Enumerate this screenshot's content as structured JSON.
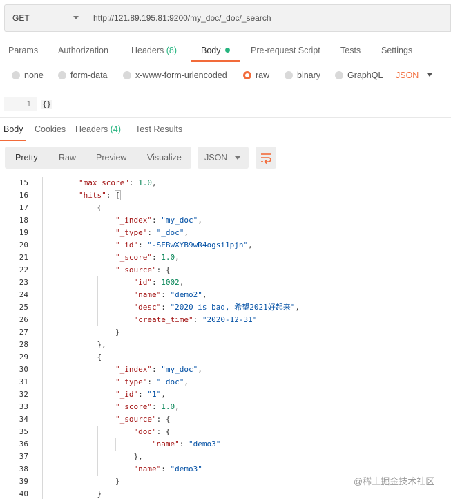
{
  "request": {
    "method": "GET",
    "url": "http://121.89.195.81:9200/my_doc/_doc/_search"
  },
  "request_tabs": [
    {
      "label": "Params",
      "count": ""
    },
    {
      "label": "Authorization",
      "count": ""
    },
    {
      "label": "Headers",
      "count": "(8)"
    },
    {
      "label": "Body",
      "count": ""
    },
    {
      "label": "Pre-request Script",
      "count": ""
    },
    {
      "label": "Tests",
      "count": ""
    },
    {
      "label": "Settings",
      "count": ""
    }
  ],
  "body_types": [
    "none",
    "form-data",
    "x-www-form-urlencoded",
    "raw",
    "binary",
    "GraphQL"
  ],
  "body_selected": "raw",
  "body_format": "JSON",
  "request_body": {
    "line": "1",
    "code": "{}"
  },
  "response_tabs": [
    {
      "label": "Body",
      "count": ""
    },
    {
      "label": "Cookies",
      "count": ""
    },
    {
      "label": "Headers",
      "count": "(4)"
    },
    {
      "label": "Test Results",
      "count": ""
    }
  ],
  "view_modes": [
    "Pretty",
    "Raw",
    "Preview",
    "Visualize"
  ],
  "response_format": "JSON",
  "response_lines": [
    {
      "n": "15",
      "i": 2,
      "parts": [
        [
          "k",
          "\"max_score\""
        ],
        [
          "",
          ": "
        ],
        [
          "n",
          "1.0"
        ],
        [
          "",
          ","
        ]
      ]
    },
    {
      "n": "16",
      "i": 2,
      "parts": [
        [
          "k",
          "\"hits\""
        ],
        [
          "",
          ": "
        ],
        [
          "b",
          "["
        ]
      ]
    },
    {
      "n": "17",
      "i": 3,
      "parts": [
        [
          "",
          "{"
        ]
      ]
    },
    {
      "n": "18",
      "i": 4,
      "parts": [
        [
          "k",
          "\"_index\""
        ],
        [
          "",
          ": "
        ],
        [
          "s",
          "\"my_doc\""
        ],
        [
          "",
          ","
        ]
      ]
    },
    {
      "n": "19",
      "i": 4,
      "parts": [
        [
          "k",
          "\"_type\""
        ],
        [
          "",
          ": "
        ],
        [
          "s",
          "\"_doc\""
        ],
        [
          "",
          ","
        ]
      ]
    },
    {
      "n": "20",
      "i": 4,
      "parts": [
        [
          "k",
          "\"_id\""
        ],
        [
          "",
          ": "
        ],
        [
          "s",
          "\"-SEBwXYB9wR4ogsi1pjn\""
        ],
        [
          "",
          ","
        ]
      ]
    },
    {
      "n": "21",
      "i": 4,
      "parts": [
        [
          "k",
          "\"_score\""
        ],
        [
          "",
          ": "
        ],
        [
          "n",
          "1.0"
        ],
        [
          "",
          ","
        ]
      ]
    },
    {
      "n": "22",
      "i": 4,
      "parts": [
        [
          "k",
          "\"_source\""
        ],
        [
          "",
          ": {"
        ]
      ]
    },
    {
      "n": "23",
      "i": 5,
      "parts": [
        [
          "k",
          "\"id\""
        ],
        [
          "",
          ": "
        ],
        [
          "n",
          "1002"
        ],
        [
          "",
          ","
        ]
      ]
    },
    {
      "n": "24",
      "i": 5,
      "parts": [
        [
          "k",
          "\"name\""
        ],
        [
          "",
          ": "
        ],
        [
          "s",
          "\"demo2\""
        ],
        [
          "",
          ","
        ]
      ]
    },
    {
      "n": "25",
      "i": 5,
      "parts": [
        [
          "k",
          "\"desc\""
        ],
        [
          "",
          ": "
        ],
        [
          "s",
          "\"2020 is bad, 希望2021好起来\""
        ],
        [
          "",
          ","
        ]
      ]
    },
    {
      "n": "26",
      "i": 5,
      "parts": [
        [
          "k",
          "\"create_time\""
        ],
        [
          "",
          ": "
        ],
        [
          "s",
          "\"2020-12-31\""
        ]
      ]
    },
    {
      "n": "27",
      "i": 4,
      "parts": [
        [
          "",
          "}"
        ]
      ]
    },
    {
      "n": "28",
      "i": 3,
      "parts": [
        [
          "",
          "},"
        ]
      ]
    },
    {
      "n": "29",
      "i": 3,
      "parts": [
        [
          "",
          "{"
        ]
      ]
    },
    {
      "n": "30",
      "i": 4,
      "parts": [
        [
          "k",
          "\"_index\""
        ],
        [
          "",
          ": "
        ],
        [
          "s",
          "\"my_doc\""
        ],
        [
          "",
          ","
        ]
      ]
    },
    {
      "n": "31",
      "i": 4,
      "parts": [
        [
          "k",
          "\"_type\""
        ],
        [
          "",
          ": "
        ],
        [
          "s",
          "\"_doc\""
        ],
        [
          "",
          ","
        ]
      ]
    },
    {
      "n": "32",
      "i": 4,
      "parts": [
        [
          "k",
          "\"_id\""
        ],
        [
          "",
          ": "
        ],
        [
          "s",
          "\"1\""
        ],
        [
          "",
          ","
        ]
      ]
    },
    {
      "n": "33",
      "i": 4,
      "parts": [
        [
          "k",
          "\"_score\""
        ],
        [
          "",
          ": "
        ],
        [
          "n",
          "1.0"
        ],
        [
          "",
          ","
        ]
      ]
    },
    {
      "n": "34",
      "i": 4,
      "parts": [
        [
          "k",
          "\"_source\""
        ],
        [
          "",
          ": {"
        ]
      ]
    },
    {
      "n": "35",
      "i": 5,
      "parts": [
        [
          "k",
          "\"doc\""
        ],
        [
          "",
          ": {"
        ]
      ]
    },
    {
      "n": "36",
      "i": 6,
      "parts": [
        [
          "k",
          "\"name\""
        ],
        [
          "",
          ": "
        ],
        [
          "s",
          "\"demo3\""
        ]
      ]
    },
    {
      "n": "37",
      "i": 5,
      "parts": [
        [
          "",
          "},"
        ]
      ]
    },
    {
      "n": "38",
      "i": 5,
      "parts": [
        [
          "k",
          "\"name\""
        ],
        [
          "",
          ": "
        ],
        [
          "s",
          "\"demo3\""
        ]
      ]
    },
    {
      "n": "39",
      "i": 4,
      "parts": [
        [
          "",
          "}"
        ]
      ]
    },
    {
      "n": "40",
      "i": 3,
      "parts": [
        [
          "",
          "}"
        ]
      ]
    }
  ],
  "watermark": "@稀土掘金技术社区"
}
